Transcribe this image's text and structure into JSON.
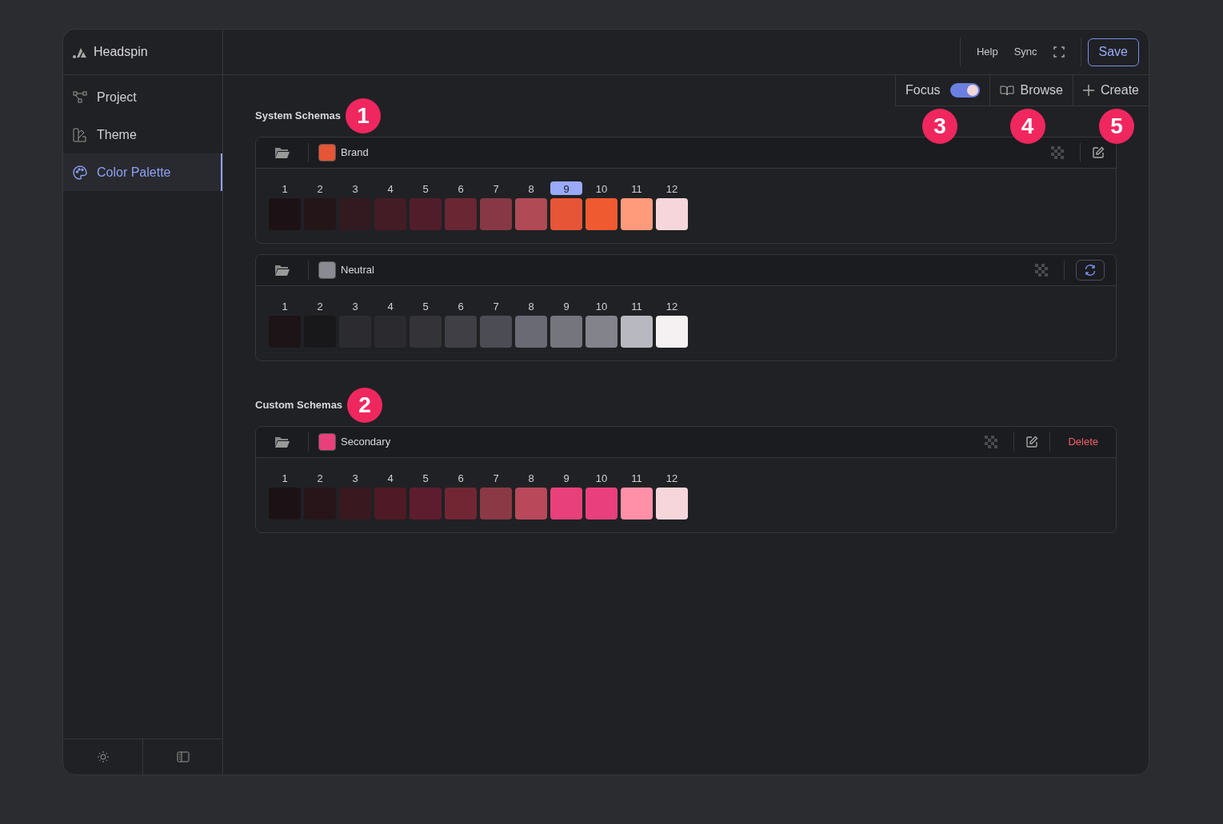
{
  "app": {
    "name": "Headspin"
  },
  "sidebar": {
    "items": [
      {
        "label": "Project",
        "selected": false
      },
      {
        "label": "Theme",
        "selected": false
      },
      {
        "label": "Color Palette",
        "selected": true
      }
    ]
  },
  "header": {
    "links": [
      "Help",
      "Sync"
    ],
    "save": "Save"
  },
  "toolbar": {
    "focus": {
      "label": "Focus",
      "on": true,
      "badge": "3"
    },
    "browse": {
      "label": "Browse",
      "badge": "4"
    },
    "create": {
      "label": "Create",
      "badge": "5"
    }
  },
  "sections": [
    {
      "title": "System Schemas",
      "badge": "1",
      "schemas": [
        {
          "name": "Brand",
          "color": "#e65536",
          "actions": [
            {
              "kind": "edit"
            }
          ],
          "swatches": [
            {
              "label": "1",
              "color": "#1c1216",
              "selected": false
            },
            {
              "label": "2",
              "color": "#241519",
              "selected": false
            },
            {
              "label": "3",
              "color": "#331a20",
              "selected": false
            },
            {
              "label": "4",
              "color": "#441c25",
              "selected": false
            },
            {
              "label": "5",
              "color": "#521d2b",
              "selected": false
            },
            {
              "label": "6",
              "color": "#6b2634",
              "selected": false
            },
            {
              "label": "7",
              "color": "#883845",
              "selected": false
            },
            {
              "label": "8",
              "color": "#b04a55",
              "selected": false
            },
            {
              "label": "9",
              "color": "#e65536",
              "selected": true
            },
            {
              "label": "10",
              "color": "#ef5a30",
              "selected": false
            },
            {
              "label": "11",
              "color": "#ff9a7a",
              "selected": false
            },
            {
              "label": "12",
              "color": "#f7d6db",
              "selected": false
            }
          ]
        },
        {
          "name": "Neutral",
          "color": "#8a8a92",
          "actions": [
            {
              "kind": "sync"
            }
          ],
          "swatches": [
            {
              "label": "1",
              "color": "#1c1416",
              "selected": false
            },
            {
              "label": "2",
              "color": "#18181a",
              "selected": false
            },
            {
              "label": "3",
              "color": "#2c2c30",
              "selected": false
            },
            {
              "label": "4",
              "color": "#2b2b2f",
              "selected": false
            },
            {
              "label": "5",
              "color": "#333338",
              "selected": false
            },
            {
              "label": "6",
              "color": "#3f3f45",
              "selected": false
            },
            {
              "label": "7",
              "color": "#4c4c55",
              "selected": false
            },
            {
              "label": "8",
              "color": "#6a6a74",
              "selected": false
            },
            {
              "label": "9",
              "color": "#75757e",
              "selected": false
            },
            {
              "label": "10",
              "color": "#83838c",
              "selected": false
            },
            {
              "label": "11",
              "color": "#b8b8c0",
              "selected": false
            },
            {
              "label": "12",
              "color": "#f5f0f2",
              "selected": false
            }
          ]
        }
      ]
    },
    {
      "title": "Custom Schemas",
      "badge": "2",
      "schemas": [
        {
          "name": "Secondary",
          "color": "#e8407a",
          "actions": [
            {
              "kind": "edit"
            },
            {
              "kind": "delete",
              "label": "Delete"
            }
          ],
          "swatches": [
            {
              "label": "1",
              "color": "#1c1216",
              "selected": false
            },
            {
              "label": "2",
              "color": "#271519",
              "selected": false
            },
            {
              "label": "3",
              "color": "#3a1820",
              "selected": false
            },
            {
              "label": "4",
              "color": "#4f1a26",
              "selected": false
            },
            {
              "label": "5",
              "color": "#5e1d2e",
              "selected": false
            },
            {
              "label": "6",
              "color": "#722634",
              "selected": false
            },
            {
              "label": "7",
              "color": "#8a3945",
              "selected": false
            },
            {
              "label": "8",
              "color": "#b8485a",
              "selected": false
            },
            {
              "label": "9",
              "color": "#e8407a",
              "selected": false
            },
            {
              "label": "10",
              "color": "#ea3f7d",
              "selected": false
            },
            {
              "label": "11",
              "color": "#ff90a8",
              "selected": false
            },
            {
              "label": "12",
              "color": "#f7d6db",
              "selected": false
            }
          ]
        }
      ]
    }
  ]
}
